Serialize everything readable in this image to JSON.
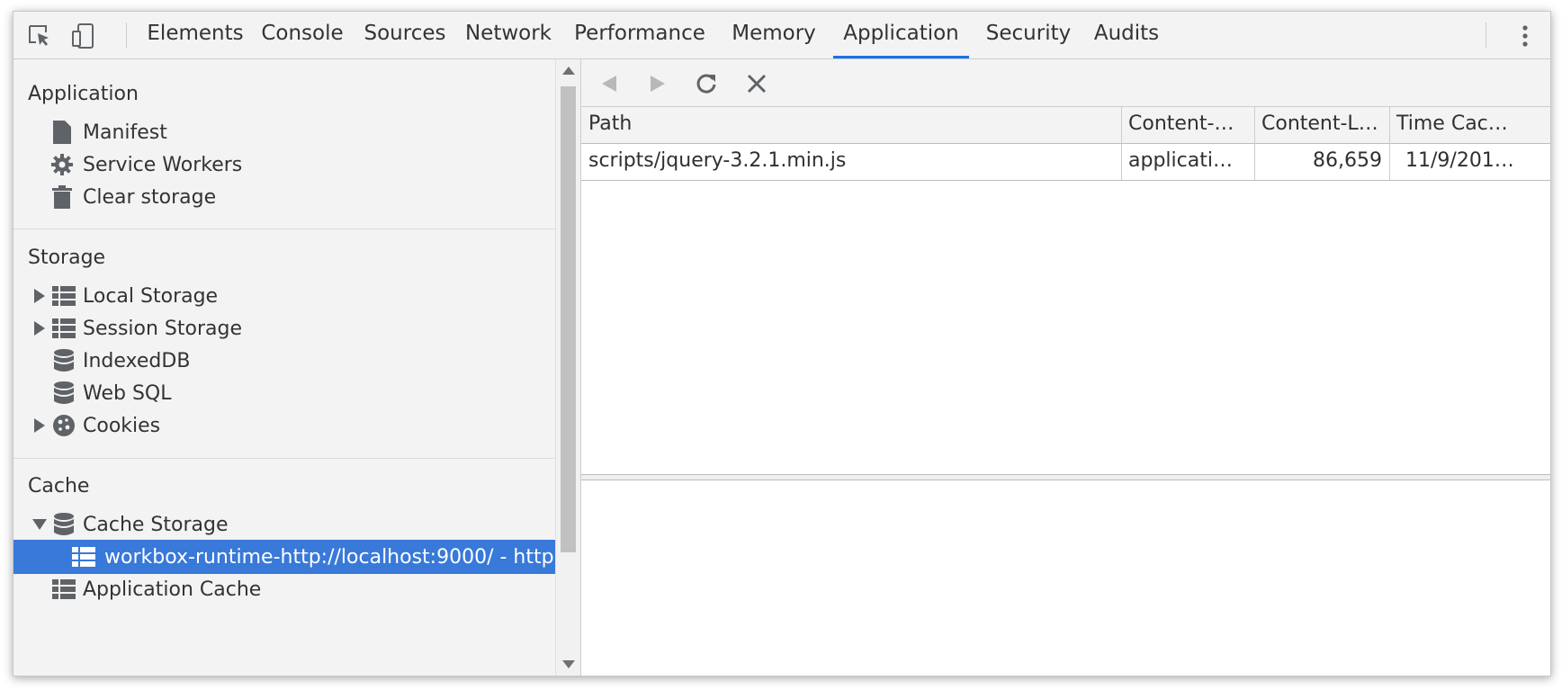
{
  "toolbar": {
    "tabs": [
      "Elements",
      "Console",
      "Sources",
      "Network",
      "Performance",
      "Memory",
      "Application",
      "Security",
      "Audits"
    ],
    "active_tab": "Application"
  },
  "sidebar": {
    "application": {
      "title": "Application",
      "items": [
        "Manifest",
        "Service Workers",
        "Clear storage"
      ]
    },
    "storage": {
      "title": "Storage",
      "items": [
        "Local Storage",
        "Session Storage",
        "IndexedDB",
        "Web SQL",
        "Cookies"
      ]
    },
    "cache": {
      "title": "Cache",
      "items": [
        "Cache Storage",
        "workbox-runtime-http://localhost:9000/ - http",
        "Application Cache"
      ]
    }
  },
  "table": {
    "columns": [
      "Path",
      "Content-…",
      "Content-L…",
      "Time Cac…"
    ],
    "rows": [
      [
        "scripts/jquery-3.2.1.min.js",
        "applicati…",
        "86,659",
        "11/9/201…"
      ]
    ]
  },
  "colors": {
    "accent": "#1a73e8",
    "selection": "#3879d9"
  }
}
